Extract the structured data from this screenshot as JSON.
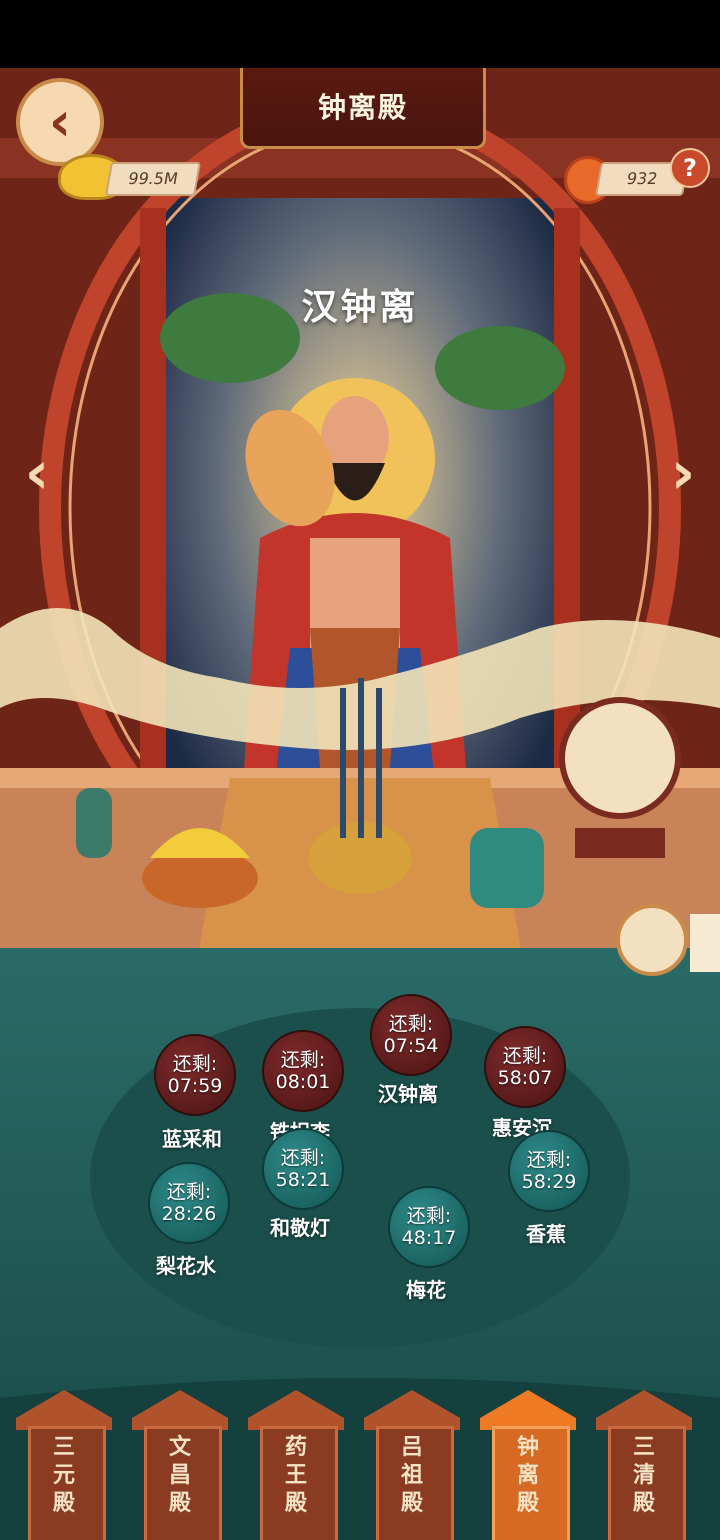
{
  "header": {
    "temple_title": "钟离殿"
  },
  "currency": {
    "gold": "99.5M",
    "flowers": "932"
  },
  "deity": {
    "name": "汉钟离"
  },
  "offerings": [
    {
      "prefix": "还剩:",
      "time": "07:59",
      "label": "蓝采和",
      "style": "red"
    },
    {
      "prefix": "还剩:",
      "time": "08:01",
      "label": "铁拐李",
      "style": "red"
    },
    {
      "prefix": "还剩:",
      "time": "07:54",
      "label": "汉钟离",
      "style": "red"
    },
    {
      "prefix": "还剩:",
      "time": "58:07",
      "label": "惠安沉",
      "style": "red"
    },
    {
      "prefix": "还剩:",
      "time": "58:21",
      "label": "和敬灯",
      "style": "teal"
    },
    {
      "prefix": "还剩:",
      "time": "28:26",
      "label": "梨花水",
      "style": "teal"
    },
    {
      "prefix": "还剩:",
      "time": "58:29",
      "label": "香蕉",
      "style": "teal"
    },
    {
      "prefix": "还剩:",
      "time": "48:17",
      "label": "梅花",
      "style": "teal"
    }
  ],
  "tabs": [
    {
      "label": "三元殿",
      "active": false
    },
    {
      "label": "文昌殿",
      "active": false
    },
    {
      "label": "药王殿",
      "active": false
    },
    {
      "label": "吕祖殿",
      "active": false
    },
    {
      "label": "钟离殿",
      "active": true
    },
    {
      "label": "三清殿",
      "active": false
    }
  ],
  "icons": {
    "back": "back-arrow-icon",
    "gold": "gold-ingot-icon",
    "flower": "flower-icon",
    "help": "help-icon",
    "prev": "chevron-left-icon",
    "next": "chevron-right-icon"
  },
  "colors": {
    "accent": "#d76a22",
    "temple_red": "#7a2a1e",
    "floor_teal": "#1f5f5c"
  }
}
